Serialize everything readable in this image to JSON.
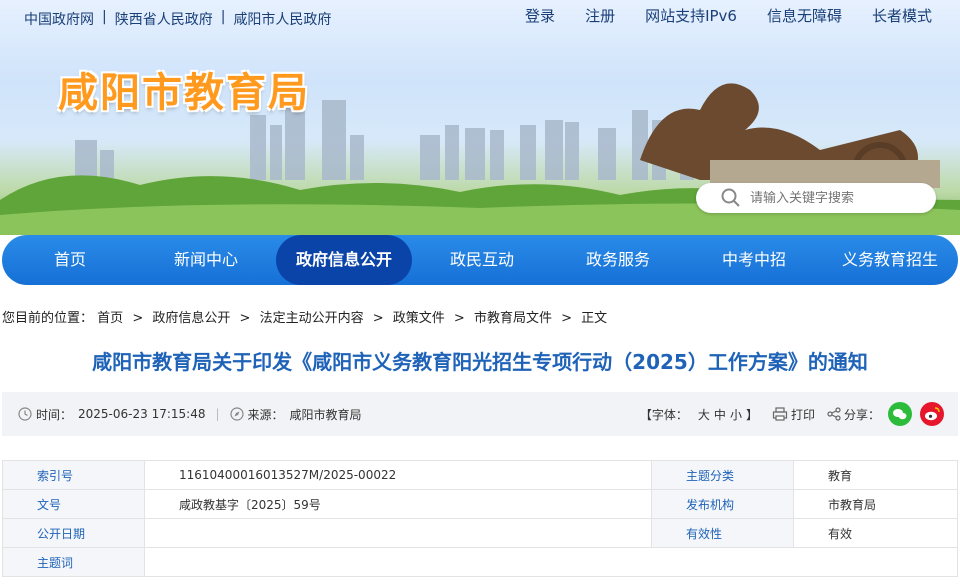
{
  "header": {
    "top_links": [
      "中国政府网",
      "陕西省人民政府",
      "咸阳市人民政府"
    ],
    "top_right": [
      "登录",
      "注册",
      "网站支持IPv6",
      "信息无障碍",
      "长者模式"
    ],
    "logo_text": "咸阳市教育局",
    "search_placeholder": "请输入关键字搜索"
  },
  "nav": {
    "items": [
      "首页",
      "新闻中心",
      "政府信息公开",
      "政民互动",
      "政务服务",
      "中考中招",
      "义务教育招生"
    ],
    "active_index": 2
  },
  "breadcrumb": {
    "prefix": "您目前的位置：",
    "items": [
      "首页",
      "政府信息公开",
      "法定主动公开内容",
      "政策文件",
      "市教育局文件",
      "正文"
    ]
  },
  "article": {
    "title": "咸阳市教育局关于印发《咸阳市义务教育阳光招生专项行动（2025）工作方案》的通知",
    "time_label": "时间：",
    "time": "2025-06-23 17:15:48",
    "source_label": "来源：",
    "source": "咸阳市教育局",
    "font_size_label": "【字体：",
    "font_big": "大",
    "font_mid": "中",
    "font_small": "小",
    "font_close": "】",
    "print_label": "打印",
    "share_label": "分享："
  },
  "info_table": {
    "rows": [
      {
        "k1": "索引号",
        "v1": "11610400016013527M/2025-00022",
        "k2": "主题分类",
        "v2": "教育"
      },
      {
        "k1": "文号",
        "v1": "咸政教基字〔2025〕59号",
        "k2": "发布机构",
        "v2": "市教育局"
      },
      {
        "k1": "公开日期",
        "v1": "",
        "k2": "有效性",
        "v2": "有效"
      },
      {
        "k1": "主题词",
        "v1": "",
        "k2": "",
        "v2": ""
      }
    ]
  },
  "colors": {
    "nav_blue": "#1670d6",
    "nav_active": "#0a44a8",
    "title_blue": "#1f63b8",
    "logo_orange": "#ff9a1f"
  }
}
